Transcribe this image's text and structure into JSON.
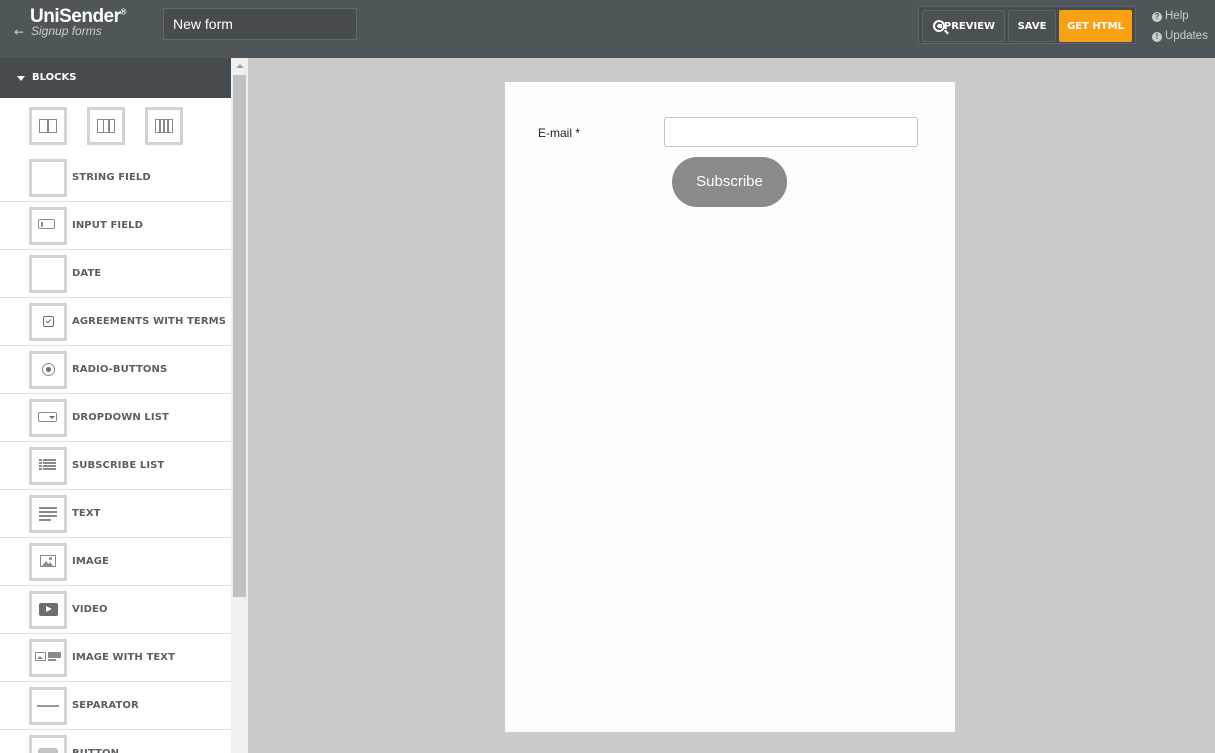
{
  "header": {
    "brand_name": "UniSender",
    "brand_reg": "®",
    "back_arrow": "←",
    "brand_sub": "Signup forms",
    "form_name": "New form",
    "preview_label": "PREVIEW",
    "save_label": "SAVE",
    "get_html_label": "GET HTML",
    "help_label": "Help",
    "help_icon": "?",
    "updates_label": "Updates",
    "updates_icon": "!"
  },
  "sidebar": {
    "section_title": "BLOCKS",
    "columns": [
      {
        "name": "two-columns-icon",
        "count": 2
      },
      {
        "name": "three-columns-icon",
        "count": 3
      },
      {
        "name": "four-columns-icon",
        "count": 4
      }
    ],
    "items": [
      {
        "label": "STRING FIELD",
        "icon": "string-field-icon"
      },
      {
        "label": "INPUT FIELD",
        "icon": "input-field-icon"
      },
      {
        "label": "DATE",
        "icon": "date-icon"
      },
      {
        "label": "AGREEMENTS WITH TERMS",
        "icon": "checkbox-icon"
      },
      {
        "label": "RADIO-BUTTONS",
        "icon": "radio-icon"
      },
      {
        "label": "DROPDOWN LIST",
        "icon": "dropdown-icon"
      },
      {
        "label": "SUBSCRIBE LIST",
        "icon": "list-icon"
      },
      {
        "label": "TEXT",
        "icon": "text-icon"
      },
      {
        "label": "IMAGE",
        "icon": "image-icon"
      },
      {
        "label": "VIDEO",
        "icon": "video-icon"
      },
      {
        "label": "IMAGE WITH TEXT",
        "icon": "image-text-icon"
      },
      {
        "label": "SEPARATOR",
        "icon": "separator-icon"
      },
      {
        "label": "BUTTON",
        "icon": "button-icon"
      }
    ]
  },
  "form": {
    "email_label": "E-mail *",
    "email_value": "",
    "subscribe_label": "Subscribe",
    "button_color": "#8a8a8a"
  },
  "colors": {
    "topbar": "#4f5659",
    "accent": "#f8a114",
    "canvas": "#cbcbcb"
  }
}
